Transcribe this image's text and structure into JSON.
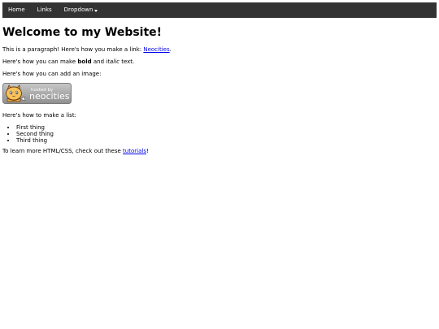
{
  "nav": {
    "items": [
      {
        "label": "Home"
      },
      {
        "label": "Links"
      },
      {
        "label": "Dropdown"
      }
    ]
  },
  "main": {
    "heading": "Welcome to my Website!",
    "p1_before": "This is a paragraph! Here's how you make a link: ",
    "p1_link": "Neocities",
    "p1_after": ".",
    "p2_before": "Here's how you can make ",
    "p2_bold": "bold",
    "p2_mid": " and ",
    "p2_italic": "italic",
    "p2_after": " text.",
    "p3": "Here's how you can add an image:",
    "badge": {
      "small": "hosted by",
      "big": "neocities"
    },
    "list_intro": "Here's how to make a list:",
    "list": [
      "First thing",
      "Second thing",
      "Third thing"
    ],
    "p_last_before": "To learn more HTML/CSS, check out these ",
    "p_last_link": "tutorials",
    "p_last_after": "!"
  },
  "colors": {
    "navbar_bg": "#333333",
    "link": "#0000ee"
  }
}
